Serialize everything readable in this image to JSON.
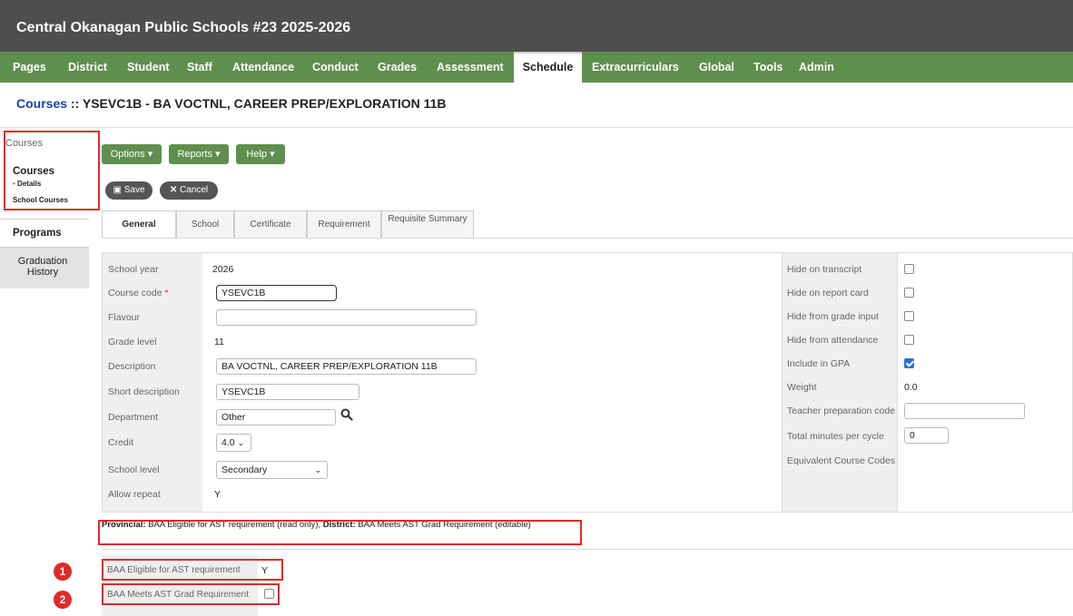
{
  "header": {
    "title": "Central Okanagan Public Schools #23 2025-2026"
  },
  "menu": {
    "items": [
      "Pages",
      "District",
      "Student",
      "Staff",
      "Attendance",
      "Conduct",
      "Grades",
      "Assessment",
      "Schedule",
      "Extracurriculars",
      "Global",
      "Tools",
      "Admin"
    ],
    "active": "Schedule"
  },
  "page": {
    "title_link": "Courses",
    "title_rest": " :: YSEVC1B - BA VOCTNL, CAREER PREP/EXPLORATION 11B"
  },
  "sidebar": {
    "heading": "Courses",
    "courses": "Courses",
    "details": "Details",
    "school_courses": "School Courses",
    "programs": "Programs",
    "graduation_history": "Graduation History"
  },
  "toolbar": {
    "options": "Options",
    "reports": "Reports",
    "help": "Help",
    "save": "Save",
    "cancel": "Cancel"
  },
  "tabs": [
    "General",
    "School",
    "Certificate",
    "Requirement",
    "Requisite Summary"
  ],
  "form": {
    "school_year": {
      "label": "School year",
      "value": "2026"
    },
    "course_code": {
      "label": "Course code",
      "value": "YSEVC1B"
    },
    "flavour": {
      "label": "Flavour",
      "value": ""
    },
    "grade_level": {
      "label": "Grade level",
      "value": "11"
    },
    "description": {
      "label": "Description",
      "value": "BA VOCTNL, CAREER PREP/EXPLORATION 11B"
    },
    "short_description": {
      "label": "Short description",
      "value": "YSEVC1B"
    },
    "department": {
      "label": "Department",
      "value": "Other"
    },
    "credit": {
      "label": "Credit",
      "value": "4.0"
    },
    "school_level": {
      "label": "School level",
      "value": "Secondary"
    },
    "allow_repeat": {
      "label": "Allow repeat",
      "value": "Y"
    }
  },
  "right_form": {
    "hide_transcript": {
      "label": "Hide on transcript",
      "checked": false
    },
    "hide_report_card": {
      "label": "Hide on report card",
      "checked": false
    },
    "hide_grade_input": {
      "label": "Hide from grade input",
      "checked": false
    },
    "hide_attendance": {
      "label": "Hide from attendance",
      "checked": false
    },
    "include_gpa": {
      "label": "Include in GPA",
      "checked": true
    },
    "weight": {
      "label": "Weight",
      "value": "0.0"
    },
    "teacher_prep": {
      "label": "Teacher preparation code",
      "value": ""
    },
    "total_minutes": {
      "label": "Total minutes per cycle",
      "value": "0"
    },
    "equivalent": {
      "label": "Equivalent Course Codes"
    }
  },
  "note": {
    "prov_label": "Provincial:",
    "prov_text": " BAA Eligible for AST requirement (read only), ",
    "dist_label": "District:",
    "dist_text": " BAA Meets AST Grad Requirement (editable)"
  },
  "baa": {
    "eligible": {
      "label": "BAA Eligible for AST requirement",
      "value": "Y"
    },
    "meets": {
      "label": "BAA Meets AST Grad Requirement",
      "checked": false
    }
  },
  "badges": [
    "1",
    "2"
  ]
}
